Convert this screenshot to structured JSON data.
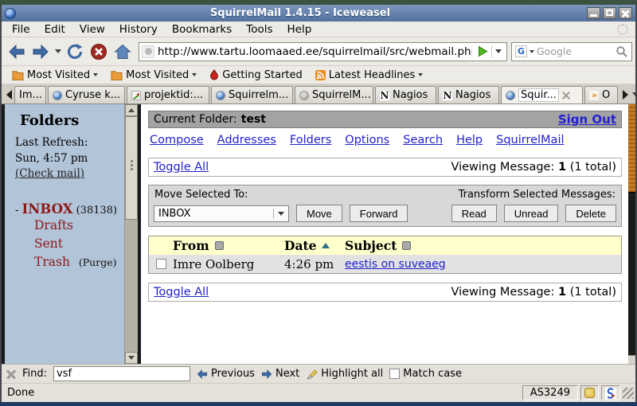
{
  "titlebar": {
    "title": "SquirrelMail 1.4.15 - Iceweasel"
  },
  "menubar": {
    "items": [
      "File",
      "Edit",
      "View",
      "History",
      "Bookmarks",
      "Tools",
      "Help"
    ]
  },
  "navbar": {
    "url": "http://www.tartu.loomaaed.ee/squirrelmail/src/webmail.php",
    "search_placeholder": "Google"
  },
  "bookmarksbar": {
    "items": [
      "Most Visited",
      "Most Visited",
      "Getting Started",
      "Latest Headlines"
    ]
  },
  "tabbar": {
    "tabs": [
      {
        "label": "Im..."
      },
      {
        "label": "Cyruse k..."
      },
      {
        "label": "projektid:..."
      },
      {
        "label": "Squirrelm..."
      },
      {
        "label": "SquirrelM..."
      },
      {
        "label": "Nagios"
      },
      {
        "label": "Nagios"
      },
      {
        "label": "Squir..."
      },
      {
        "label": "O"
      }
    ]
  },
  "icons": {
    "nagios_glyph": "N",
    "overflow_glyph": "»",
    "google_g": "G"
  },
  "sidebar": {
    "title": "Folders",
    "last_refresh_label": "Last Refresh:",
    "last_refresh_time": "Sun, 4:57 pm",
    "check_mail": "(Check mail)",
    "inbox": {
      "prefix": "-",
      "label": "INBOX",
      "count": "(38138)"
    },
    "folders": [
      {
        "label": "Drafts"
      },
      {
        "label": "Sent"
      },
      {
        "label": "Trash",
        "suffix": "(Purge)"
      }
    ]
  },
  "main": {
    "current_folder_label": "Current Folder:",
    "current_folder_name": "test",
    "sign_out": "Sign Out",
    "nav_links": [
      "Compose",
      "Addresses",
      "Folders",
      "Options",
      "Search",
      "Help",
      "SquirrelMail"
    ],
    "toggle_all": "Toggle All",
    "viewing": {
      "label": "Viewing Message:",
      "current": "1",
      "total": "(1 total)"
    },
    "move_to": {
      "label": "Move Selected To:",
      "selected": "INBOX",
      "move": "Move",
      "forward": "Forward"
    },
    "transform": {
      "label": "Transform Selected Messages:",
      "read": "Read",
      "unread": "Unread",
      "delete": "Delete"
    },
    "table": {
      "headers": {
        "from": "From",
        "date": "Date",
        "subject": "Subject"
      },
      "rows": [
        {
          "from": "Imre Oolberg",
          "date": "4:26 pm",
          "subject": "eestis on suveaeg"
        }
      ]
    }
  },
  "findbar": {
    "label": "Find:",
    "value": "vsf",
    "previous": "Previous",
    "next": "Next",
    "highlight_all": "Highlight all",
    "match_case": "Match case"
  },
  "statusbar": {
    "status": "Done",
    "asn": "AS3249"
  },
  "colors": {
    "titlebar": "#5d7ea9",
    "sidebar_bg": "#b2c4d8",
    "folder_link": "#8b1a1a",
    "table_header_bg": "#ffffcc",
    "link": "#2222cc",
    "scroll_thumb_orange": "#c77c25"
  }
}
